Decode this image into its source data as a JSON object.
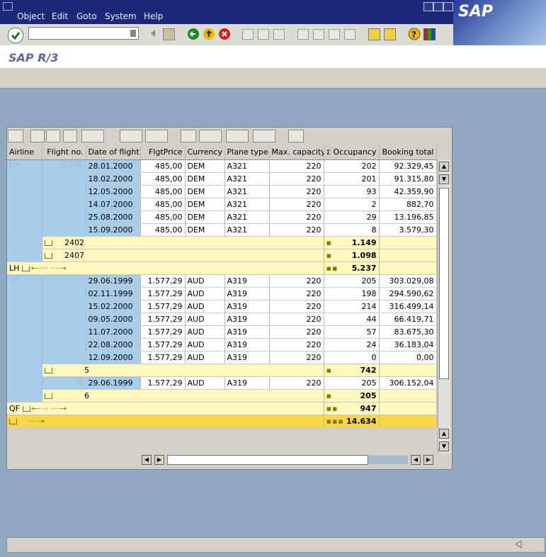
{
  "menu": {
    "items": [
      "Object",
      "Edit",
      "Goto",
      "System",
      "Help"
    ]
  },
  "logo_text": "SAP",
  "title": "SAP R/3",
  "colors": {
    "menubar": "#1a2a78",
    "key_col": "#a8cdea",
    "subtotal": "#fdf7c0",
    "total": "#f8d84a"
  },
  "grid": {
    "columns": [
      "Airline",
      "Flight no.",
      "Date of flight",
      "FlgtPrice",
      "Currency",
      "Plane type",
      "Max. capacity",
      "Occupancy",
      "Booking total"
    ],
    "sum_marker": "Σ",
    "rows_lh": [
      {
        "airline": "LH",
        "flight": "2402",
        "date": "28.01.2000",
        "price": "485,00",
        "cur": "DEM",
        "plane": "A321",
        "cap": "220",
        "occ": "202",
        "book": "92.329,45"
      },
      {
        "date": "18.02.2000",
        "price": "485,00",
        "cur": "DEM",
        "plane": "A321",
        "cap": "220",
        "occ": "201",
        "book": "91.315,80"
      },
      {
        "date": "12.05.2000",
        "price": "485,00",
        "cur": "DEM",
        "plane": "A321",
        "cap": "220",
        "occ": "93",
        "book": "42.359,90"
      },
      {
        "date": "14.07.2000",
        "price": "485,00",
        "cur": "DEM",
        "plane": "A321",
        "cap": "220",
        "occ": "2",
        "book": "882,70"
      },
      {
        "date": "25.08.2000",
        "price": "485,00",
        "cur": "DEM",
        "plane": "A321",
        "cap": "220",
        "occ": "29",
        "book": "13.196,85"
      },
      {
        "date": "15.09.2000",
        "price": "485,00",
        "cur": "DEM",
        "plane": "A321",
        "cap": "220",
        "occ": "8",
        "book": "3.579,30"
      }
    ],
    "sub_2402": {
      "label": "2402",
      "occ": "1.149"
    },
    "sub_2407": {
      "label": "2407",
      "occ": "1.098"
    },
    "sub_lh": {
      "label": "LH",
      "occ": "5.237"
    },
    "rows_qf": [
      {
        "airline": "QF",
        "flight": "5",
        "date": "29.06.1999",
        "price": "1.577,29",
        "cur": "AUD",
        "plane": "A319",
        "cap": "220",
        "occ": "205",
        "book": "303.029,08"
      },
      {
        "date": "02.11.1999",
        "price": "1.577,29",
        "cur": "AUD",
        "plane": "A319",
        "cap": "220",
        "occ": "198",
        "book": "294.590,62"
      },
      {
        "date": "15.02.2000",
        "price": "1.577,29",
        "cur": "AUD",
        "plane": "A319",
        "cap": "220",
        "occ": "214",
        "book": "316.499,14"
      },
      {
        "date": "09.05.2000",
        "price": "1.577,29",
        "cur": "AUD",
        "plane": "A319",
        "cap": "220",
        "occ": "44",
        "book": "66.419,71"
      },
      {
        "date": "11.07.2000",
        "price": "1.577,29",
        "cur": "AUD",
        "plane": "A319",
        "cap": "220",
        "occ": "57",
        "book": "83.675,30"
      },
      {
        "date": "22.08.2000",
        "price": "1.577,29",
        "cur": "AUD",
        "plane": "A319",
        "cap": "220",
        "occ": "24",
        "book": "36.183,04"
      },
      {
        "date": "12.09.2000",
        "price": "1.577,29",
        "cur": "AUD",
        "plane": "A319",
        "cap": "220",
        "occ": "0",
        "book": "0,00"
      }
    ],
    "sub_5": {
      "label": "5",
      "occ": "742"
    },
    "row_6": {
      "flight": "6",
      "date": "29.06.1999",
      "price": "1.577,29",
      "cur": "AUD",
      "plane": "A319",
      "cap": "220",
      "occ": "205",
      "book": "306.152,04"
    },
    "sub_6": {
      "label": "6",
      "occ": "205"
    },
    "sub_qf": {
      "label": "QF",
      "occ": "947"
    },
    "grand_total": {
      "occ": "14.634"
    }
  }
}
